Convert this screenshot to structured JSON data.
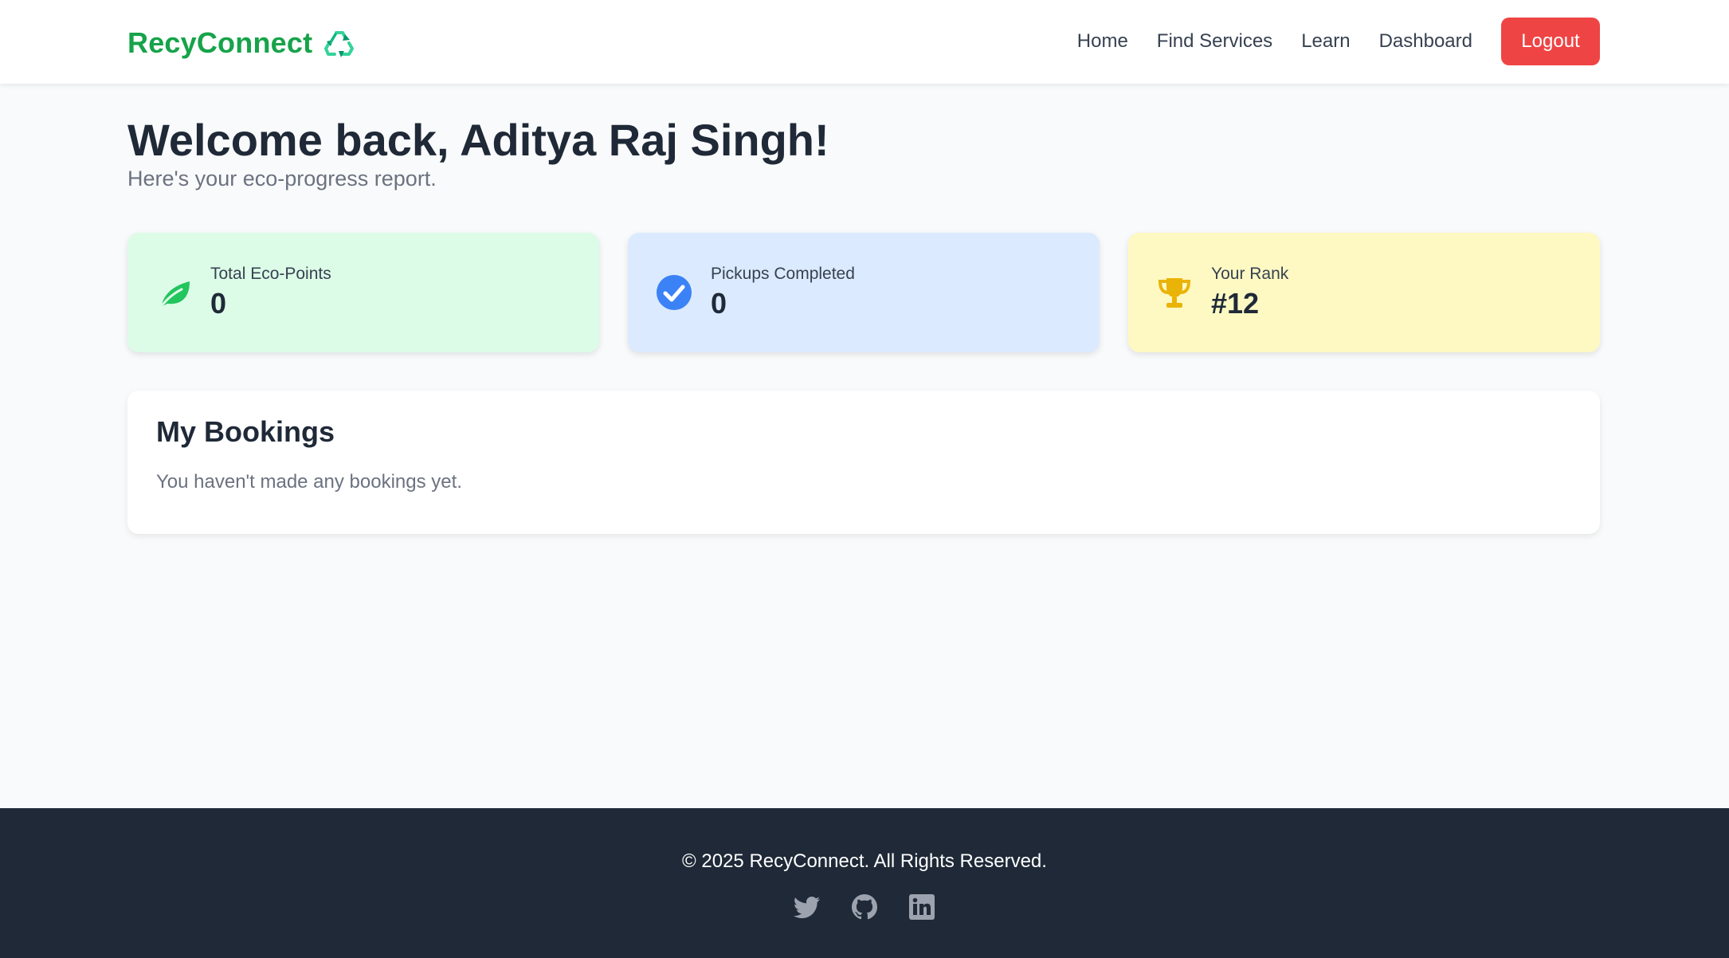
{
  "header": {
    "brand": "RecyConnect",
    "brand_icon": "recycle-icon",
    "nav": [
      "Home",
      "Find Services",
      "Learn",
      "Dashboard"
    ],
    "logout_label": "Logout"
  },
  "main": {
    "welcome": "Welcome back, Aditya Raj Singh!",
    "subtitle": "Here's your eco-progress report.",
    "stats": [
      {
        "label": "Total Eco-Points",
        "value": "0",
        "icon": "leaf-icon"
      },
      {
        "label": "Pickups Completed",
        "value": "0",
        "icon": "check-circle-icon"
      },
      {
        "label": "Your Rank",
        "value": "#12",
        "icon": "trophy-icon"
      }
    ],
    "bookings": {
      "title": "My Bookings",
      "empty": "You haven't made any bookings yet."
    }
  },
  "footer": {
    "copyright": "© 2025 RecyConnect. All Rights Reserved.",
    "social": [
      "twitter-icon",
      "github-icon",
      "linkedin-icon"
    ]
  },
  "colors": {
    "brand": "#16a34a",
    "logout": "#ef4444",
    "green_card": "#dcfce7",
    "blue_card": "#dbeafe",
    "yellow_card": "#fef9c3",
    "footer_bg": "#1f2937"
  }
}
